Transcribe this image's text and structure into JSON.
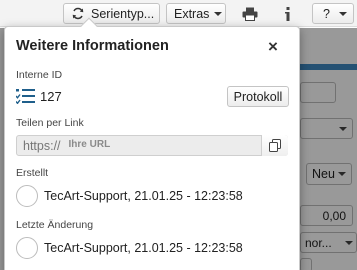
{
  "toolbar": {
    "serial_label": "Serientyp...",
    "extras_label": "Extras",
    "help_label": "?"
  },
  "popover": {
    "title": "Weitere Informationen",
    "close_symbol": "×",
    "internal_id": {
      "label": "Interne ID",
      "value": "127",
      "protocol_button": "Protokoll"
    },
    "share": {
      "label": "Teilen per Link",
      "url_prefix": "https://",
      "url_placeholder": "Ihre URL"
    },
    "created": {
      "label": "Erstellt",
      "value": "TecArt-Support, 21.01.25 - 12:23:58"
    },
    "last_change": {
      "label": "Letzte Änderung",
      "value": "TecArt-Support, 21.01.25 - 12:23:58"
    }
  },
  "background": {
    "new_label": "Neu",
    "amount_value": "0,00",
    "select_value": "nor..."
  },
  "colors": {
    "accent_blue": "#3f87c0",
    "icon_blue": "#1f5f8b"
  }
}
